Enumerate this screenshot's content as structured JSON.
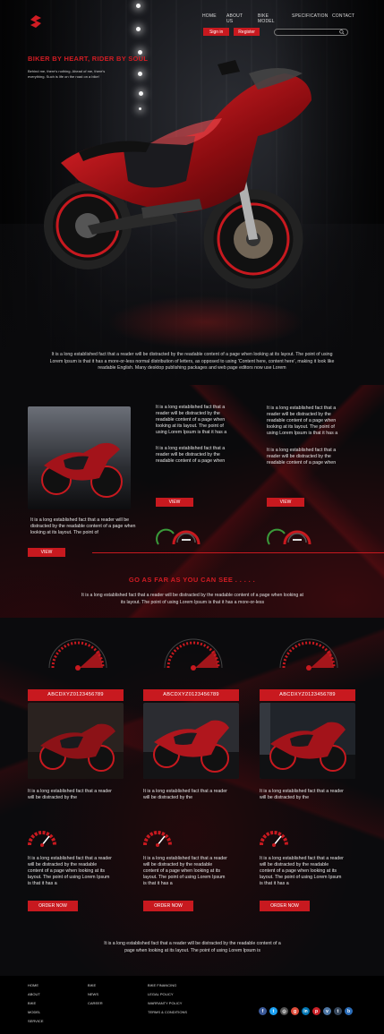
{
  "nav": {
    "items": [
      "HOME",
      "ABOUT US",
      "BIKE MODEL",
      "SPECIFICATION",
      "CONTACT"
    ],
    "signin": "Sign in",
    "register": "Register",
    "search_placeholder": ""
  },
  "hero": {
    "tagline": "BIKER BY HEART, RIDER BY SOUL",
    "subtext": "Behind me, there's nothing. Ahead of me, there's everything. Such is life on the road on a bike!",
    "paragraph": "It is a long established fact that a reader will be distracted by the readable content of a page when looking at its layout. The point of using Lorem Ipsum is that it has a more-or-less normal distribution of letters, as opposed to using 'Content here, content here', making it look like readable English. Many desktop publishing packages and web page editors now use Lorem"
  },
  "section2": {
    "card1_text": "It is a long established fact that a reader will be distracted by the readable content of a page when looking at its layout. The point of",
    "col2_text_a": "It is a long established fact that a reader will be distracted by the readable content of a page when looking at its layout. The point of using Lorem Ipsum is that it has a",
    "col2_text_b": "It is a long established fact that a reader will be distracted by the readable content of a page when",
    "col3_text_a": "It is a long established fact that a reader will be distracted by the readable content of a page when looking at its layout. The point of using Lorem Ipsum is that it has a",
    "col3_text_b": "It is a long established fact that a reader will be distracted by the readable content of a page when",
    "view_label": "VIEW"
  },
  "section3": {
    "headline": "GO AS FAR AS YOU CAN SEE . . . . .",
    "intro": "It is a long established fact that a reader will be distracted by the readable content of a page when looking at its layout. The point of using Lorem Ipsum is that it has a more-or-less",
    "code": "ABCDXYZ0123456789",
    "short_text": "It is a long established fact that a reader will be distracted by the",
    "long_text": "It is a long established fact that a reader will be distracted by the readable content of a page when looking at its layout. The point of using Lorem Ipsum is that it has a",
    "order_label": "ORDER NOW",
    "closing": "It is a long established fact that a reader will be distracted by the readable content of a page when looking at its layout. The point of using Lorem Ipsum is"
  },
  "footer": {
    "col1": [
      "HOME",
      "ABOUT",
      "BIKE",
      "MODEL",
      "SERVICE"
    ],
    "col2": [
      "BIKE",
      "NEWS",
      "CAREER"
    ],
    "col3": [
      "BIKE FINANCING",
      "LEGAL POLICY",
      "WARRANTY POLICY",
      "TERMS & CONDITIONS"
    ],
    "social": [
      {
        "name": "facebook-icon",
        "glyph": "f",
        "color": "#3b5998"
      },
      {
        "name": "twitter-icon",
        "glyph": "t",
        "color": "#1da1f2"
      },
      {
        "name": "instagram-icon",
        "glyph": "◎",
        "color": "#555555"
      },
      {
        "name": "google-plus-icon",
        "glyph": "g",
        "color": "#dd4b39"
      },
      {
        "name": "linkedin-icon",
        "glyph": "in",
        "color": "#0077b5"
      },
      {
        "name": "pinterest-icon",
        "glyph": "p",
        "color": "#cb2027"
      },
      {
        "name": "vk-icon",
        "glyph": "v",
        "color": "#4c75a3"
      },
      {
        "name": "tumblr-icon",
        "glyph": "t",
        "color": "#35465c"
      },
      {
        "name": "blogger-icon",
        "glyph": "b",
        "color": "#2a6cb8"
      }
    ]
  },
  "colors": {
    "accent": "#c8191f",
    "background": "#0b0b0d"
  }
}
